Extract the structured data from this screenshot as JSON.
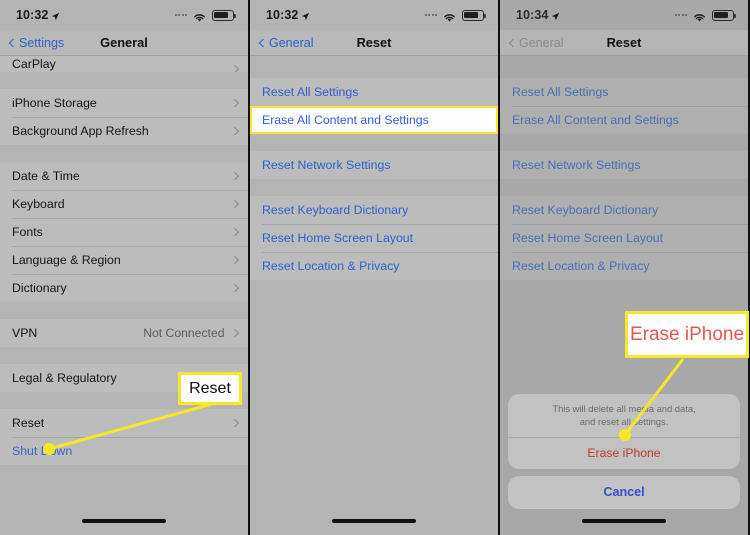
{
  "panels": [
    {
      "id": "general-settings",
      "status": {
        "time": "10:32",
        "location_icon": "location-arrow-icon",
        "wifi_icon": "wifi-icon",
        "battery_icon": "battery-icon"
      },
      "nav": {
        "back_label": "Settings",
        "title": "General"
      },
      "groups": [
        {
          "rows": [
            {
              "label": "CarPlay",
              "accessory": "chevron-right-icon",
              "partial": true
            }
          ]
        },
        {
          "rows": [
            {
              "label": "iPhone Storage",
              "accessory": "chevron-right-icon"
            },
            {
              "label": "Background App Refresh",
              "accessory": "chevron-right-icon"
            }
          ]
        },
        {
          "rows": [
            {
              "label": "Date & Time",
              "accessory": "chevron-right-icon"
            },
            {
              "label": "Keyboard",
              "accessory": "chevron-right-icon"
            },
            {
              "label": "Fonts",
              "accessory": "chevron-right-icon"
            },
            {
              "label": "Language & Region",
              "accessory": "chevron-right-icon"
            },
            {
              "label": "Dictionary",
              "accessory": "chevron-right-icon"
            }
          ]
        },
        {
          "rows": [
            {
              "label": "VPN",
              "value": "Not Connected",
              "accessory": "chevron-right-icon"
            }
          ]
        },
        {
          "rows": [
            {
              "label": "Legal & Regulatory",
              "accessory": "chevron-right-icon"
            }
          ]
        },
        {
          "rows": [
            {
              "label": "Reset",
              "accessory": "chevron-right-icon"
            },
            {
              "label": "Shut Down",
              "style": "link"
            }
          ]
        }
      ]
    },
    {
      "id": "reset-menu",
      "status": {
        "time": "10:32"
      },
      "nav": {
        "back_label": "General",
        "title": "Reset"
      },
      "groups": [
        {
          "rows": [
            {
              "label": "Reset All Settings",
              "style": "link"
            },
            {
              "label": "Erase All Content and Settings",
              "style": "link",
              "highlighted": true
            }
          ]
        },
        {
          "rows": [
            {
              "label": "Reset Network Settings",
              "style": "link"
            }
          ]
        },
        {
          "rows": [
            {
              "label": "Reset Keyboard Dictionary",
              "style": "link"
            },
            {
              "label": "Reset Home Screen Layout",
              "style": "link"
            },
            {
              "label": "Reset Location & Privacy",
              "style": "link"
            }
          ]
        }
      ]
    },
    {
      "id": "reset-confirm",
      "dimmed": true,
      "status": {
        "time": "10:34"
      },
      "nav": {
        "back_label": "General",
        "title": "Reset"
      },
      "groups": [
        {
          "rows": [
            {
              "label": "Reset All Settings",
              "style": "link"
            },
            {
              "label": "Erase All Content and Settings",
              "style": "link"
            }
          ]
        },
        {
          "rows": [
            {
              "label": "Reset Network Settings",
              "style": "link"
            }
          ]
        },
        {
          "rows": [
            {
              "label": "Reset Keyboard Dictionary",
              "style": "link"
            },
            {
              "label": "Reset Home Screen Layout",
              "style": "link"
            },
            {
              "label": "Reset Location & Privacy",
              "style": "link"
            }
          ]
        }
      ],
      "action_sheet": {
        "message": "This will delete all media and data,\nand reset all settings.",
        "destructive_label": "Erase iPhone",
        "cancel_label": "Cancel"
      }
    }
  ],
  "annotations": {
    "reset_callout": "Reset",
    "erase_callout": "Erase iPhone",
    "highlight_color": "#f7e825",
    "destructive_color": "#c0392b",
    "link_color": "#2f5fd0"
  }
}
